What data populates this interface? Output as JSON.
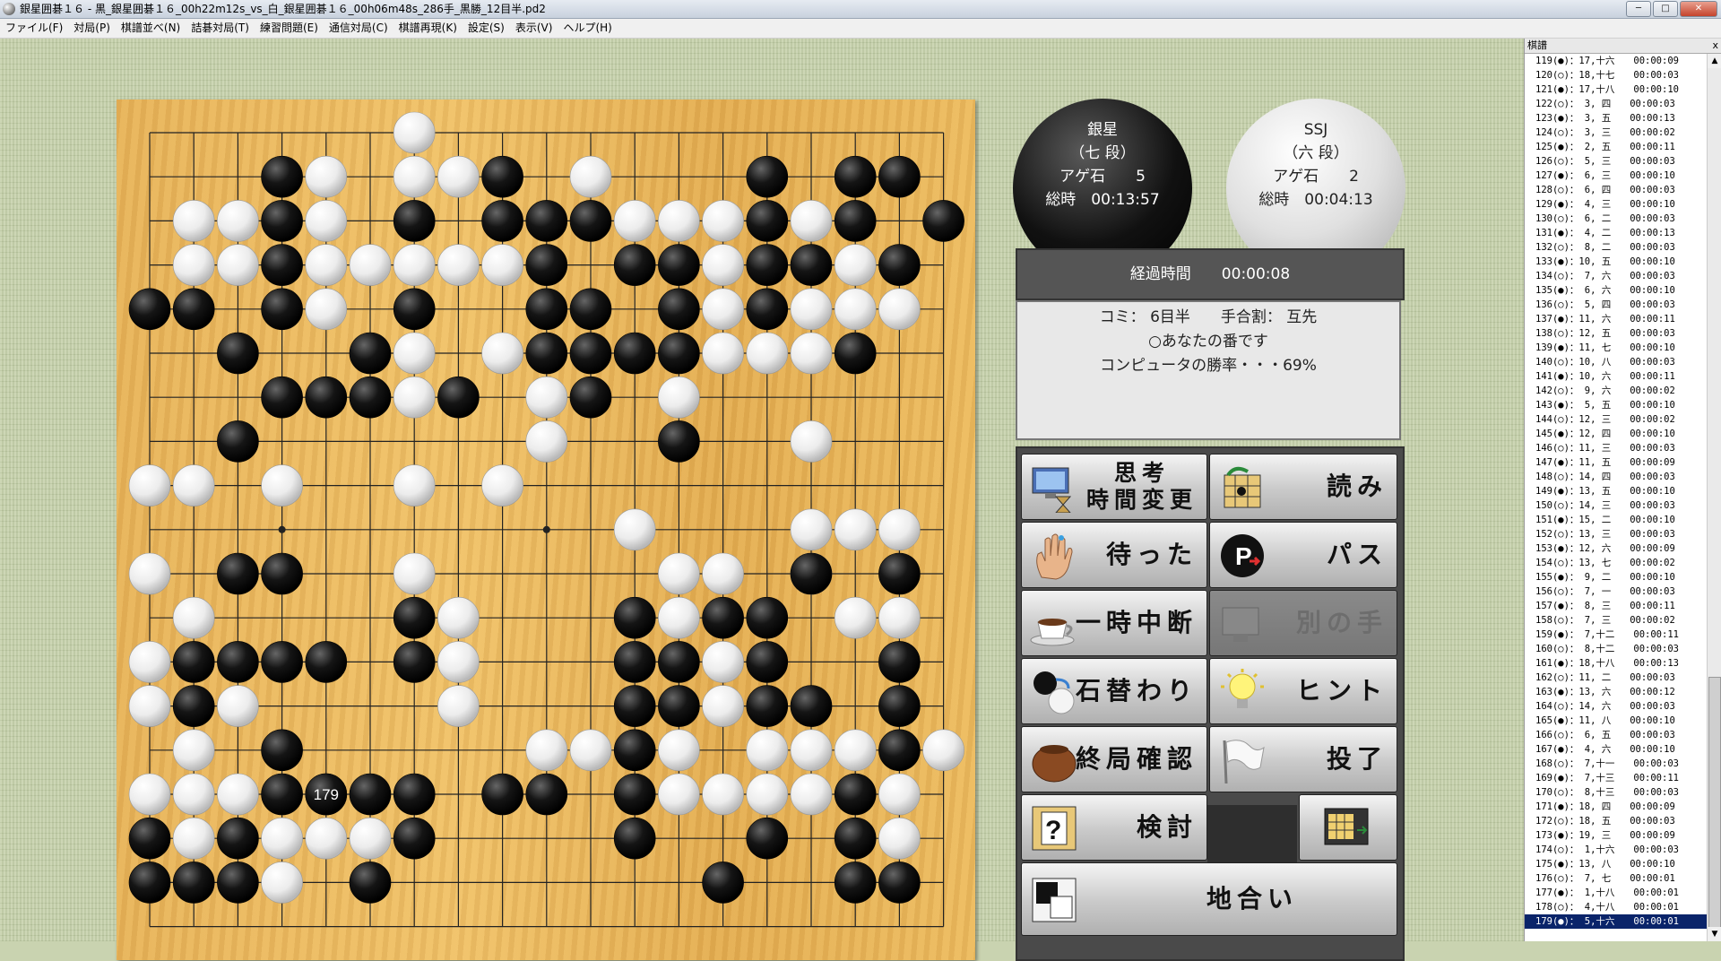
{
  "window": {
    "title": "銀星囲碁１６ - 黒_銀星囲碁１６_00h22m12s_vs_白_銀星囲碁１６_00h06m48s_286手_黒勝_12目半.pd2",
    "min": "─",
    "max": "□",
    "close": "✕"
  },
  "menu": [
    "ファイル(F)",
    "対局(P)",
    "棋譜並べ(N)",
    "詰碁対局(T)",
    "練習問題(E)",
    "通信対局(C)",
    "棋譜再現(K)",
    "設定(S)",
    "表示(V)",
    "ヘルプ(H)"
  ],
  "players": {
    "black": {
      "name": "銀星",
      "rank": "（七 段）",
      "captures": "アゲ石　　5",
      "time": "総時　00:13:57"
    },
    "white": {
      "name": "SSJ",
      "rank": "（六 段）",
      "captures": "アゲ石　　2",
      "time": "総時　00:04:13"
    }
  },
  "elapsed": "経過時間　　00:00:08",
  "info": {
    "komi": "コミ： 6目半　　手合割： 互先",
    "turn": "○あなたの番です",
    "winrate": "コンピュータの勝率・・・69%"
  },
  "buttons": {
    "think": [
      "思考",
      "時間変更"
    ],
    "read": "読み",
    "undo": "待った",
    "pass": "パス",
    "pause": "一時中断",
    "other": "別の手",
    "swap": "石替わり",
    "hint": "ヒント",
    "confirm": "終局確認",
    "resign": "投了",
    "review": "検討",
    "territory": "地合い"
  },
  "kifu": {
    "title": "棋譜",
    "close": "x",
    "moves": [
      "119(●)：17,十六　　00:00:09",
      "120(○)：18,十七　　00:00:03",
      "121(●)：17,十八　　00:00:10",
      "122(○)： 3, 四　　00:00:03",
      "123(●)： 3, 五　　00:00:13",
      "124(○)： 3, 三　　00:00:02",
      "125(●)： 2, 五　　00:00:11",
      "126(○)： 5, 三　　00:00:03",
      "127(●)： 6, 三　　00:00:10",
      "128(○)： 6, 四　　00:00:03",
      "129(●)： 4, 三　　00:00:10",
      "130(○)： 6, 二　　00:00:03",
      "131(●)： 4, 二　　00:00:13",
      "132(○)： 8, 二　　00:00:03",
      "133(●)：10, 五　　00:00:10",
      "134(○)： 7, 六　　00:00:03",
      "135(●)： 6, 六　　00:00:10",
      "136(○)： 5, 四　　00:00:03",
      "137(●)：11, 六　　00:00:11",
      "138(○)：12, 五　　00:00:03",
      "139(●)：11, 七　　00:00:10",
      "140(○)：10, 八　　00:00:03",
      "141(●)：10, 六　　00:00:11",
      "142(○)： 9, 六　　00:00:02",
      "143(●)： 5, 五　　00:00:10",
      "144(○)：12, 三　　00:00:02",
      "145(●)：12, 四　　00:00:10",
      "146(○)：11, 三　　00:00:03",
      "147(●)：11, 五　　00:00:09",
      "148(○)：14, 四　　00:00:03",
      "149(●)：13, 五　　00:00:10",
      "150(○)：14, 三　　00:00:03",
      "151(●)：15, 二　　00:00:10",
      "152(○)：13, 三　　00:00:03",
      "153(●)：12, 六　　00:00:09",
      "154(○)：13, 七　　00:00:02",
      "155(●)： 9, 二　　00:00:10",
      "156(○)： 7, 一　　00:00:03",
      "157(●)： 8, 三　　00:00:11",
      "158(○)： 7, 三　　00:00:02",
      "159(●)： 7,十二　　00:00:11",
      "160(○)： 8,十二　　00:00:03",
      "161(●)：18,十八　　00:00:13",
      "162(○)：11, 二　　00:00:03",
      "163(●)：13, 六　　00:00:12",
      "164(○)：14, 六　　00:00:03",
      "165(●)：11, 八　　00:00:10",
      "166(○)： 6, 五　　00:00:03",
      "167(●)： 4, 六　　00:00:10",
      "168(○)： 7,十一　　00:00:03",
      "169(●)： 7,十三　　00:00:11",
      "170(○)： 8,十三　　00:00:03",
      "171(●)：18, 四　　00:00:09",
      "172(○)：18, 五　　00:00:03",
      "173(●)：19, 三　　00:00:09",
      "174(○)： 1,十六　　00:00:03",
      "175(●)：13, 八　　00:00:10",
      "176(○)： 7, 七　　00:00:01",
      "177(●)： 1,十八　　00:00:01",
      "178(○)： 4,十八　　00:00:01",
      "179(●)： 5,十六　　00:00:01"
    ]
  },
  "board": {
    "last_move_number": "179",
    "last_move": "1-16",
    "stones": {
      "black": [
        "4-2",
        "9-2",
        "15-2",
        "17-2",
        "18-2",
        "4-3",
        "7-3",
        "9-3",
        "10-3",
        "11-3",
        "15-3",
        "17-3",
        "19-3",
        "4-4",
        "10-4",
        "12-4",
        "13-4",
        "15-4",
        "16-4",
        "18-4",
        "1-5",
        "2-5",
        "4-5",
        "7-5",
        "10-5",
        "11-5",
        "13-5",
        "15-5",
        "3-6",
        "6-6",
        "10-6",
        "11-6",
        "12-6",
        "13-6",
        "17-6",
        "4-7",
        "5-7",
        "6-7",
        "8-7",
        "11-7",
        "3-8",
        "13-8",
        "3-11",
        "4-11",
        "16-11",
        "18-11",
        "7-12",
        "12-12",
        "14-12",
        "15-12",
        "2-13",
        "3-13",
        "4-13",
        "5-13",
        "7-13",
        "12-13",
        "13-13",
        "15-13",
        "18-13",
        "2-14",
        "12-14",
        "13-14",
        "15-14",
        "16-14",
        "18-14",
        "4-15",
        "12-15",
        "18-15",
        "4-16",
        "5-16",
        "6-16",
        "7-16",
        "9-16",
        "10-16",
        "12-16",
        "17-16",
        "1-17",
        "3-17",
        "7-17",
        "12-17",
        "15-17",
        "17-17",
        "1-18",
        "2-18",
        "3-18",
        "6-18",
        "14-18",
        "17-18",
        "18-18"
      ],
      "white": [
        "7-1",
        "5-2",
        "7-2",
        "8-2",
        "11-2",
        "2-3",
        "3-3",
        "5-3",
        "7-3w",
        "12-3",
        "13-3",
        "14-3",
        "16-3",
        "2-4",
        "3-4",
        "5-4",
        "6-4",
        "7-4",
        "8-4",
        "9-4",
        "14-4",
        "17-4",
        "5-5",
        "14-5",
        "16-5",
        "17-5",
        "18-5",
        "7-6",
        "9-6",
        "14-6",
        "15-6",
        "16-6",
        "7-7",
        "10-7",
        "13-7",
        "10-8",
        "16-8",
        "1-9",
        "2-9",
        "4-9",
        "7-9",
        "9-9",
        "12-10",
        "16-10",
        "17-10",
        "18-10",
        "1-11",
        "7-11",
        "13-11",
        "14-11",
        "16-11w",
        "2-12",
        "8-12",
        "12-12w",
        "13-12",
        "17-12",
        "18-12",
        "1-13",
        "8-13",
        "12-13w",
        "14-13",
        "1-14",
        "3-14",
        "8-14",
        "14-14",
        "2-15",
        "10-15",
        "11-15",
        "13-15",
        "15-15",
        "16-15",
        "17-15",
        "19-15",
        "1-16",
        "2-16",
        "3-16",
        "13-16",
        "14-16",
        "15-16",
        "16-16",
        "18-16",
        "2-17",
        "4-17",
        "5-17",
        "6-17",
        "18-17",
        "4-18"
      ]
    }
  }
}
